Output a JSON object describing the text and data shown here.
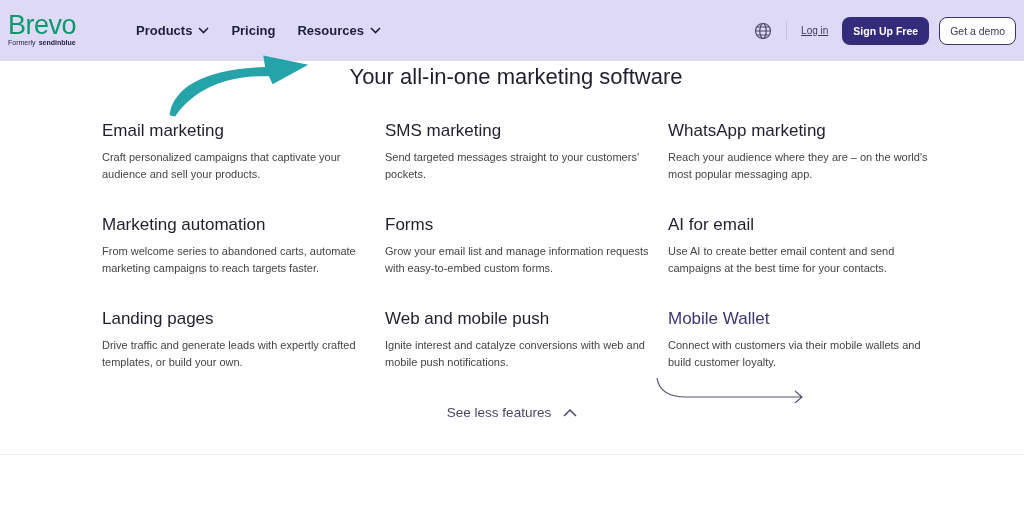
{
  "header": {
    "logo": "Brevo",
    "logo_sub_prefix": "Formerly",
    "logo_sub_brand": "sendinblue",
    "nav": [
      {
        "label": "Products",
        "dropdown": true
      },
      {
        "label": "Pricing",
        "dropdown": false
      },
      {
        "label": "Resources",
        "dropdown": true
      }
    ],
    "login": "Log in",
    "signup": "Sign Up Free",
    "demo": "Get a demo"
  },
  "heading": "Your all-in-one marketing software",
  "features": [
    {
      "title": "Email marketing",
      "text": "Craft personalized campaigns that captivate your audience and sell your products.",
      "highlighted": false
    },
    {
      "title": "SMS marketing",
      "text": "Send targeted messages straight to your customers' pockets.",
      "highlighted": false
    },
    {
      "title": "WhatsApp marketing",
      "text": "Reach your audience where they are – on the world's most popular messaging app.",
      "highlighted": false
    },
    {
      "title": "Marketing automation",
      "text": "From welcome series to abandoned carts, automate marketing campaigns to reach targets faster.",
      "highlighted": false
    },
    {
      "title": "Forms",
      "text": "Grow your email list and manage information requests with easy-to-embed custom forms.",
      "highlighted": false
    },
    {
      "title": "AI for email",
      "text": "Use AI to create better email content and send campaigns at the best time for your contacts.",
      "highlighted": false
    },
    {
      "title": "Landing pages",
      "text": "Drive traffic and generate leads with expertly crafted templates, or build your own.",
      "highlighted": false
    },
    {
      "title": "Web and mobile push",
      "text": "Ignite interest and catalyze conversions with web and mobile push notifications.",
      "highlighted": false
    },
    {
      "title": "Mobile Wallet",
      "text": "Connect with customers via their mobile wallets and build customer loyalty.",
      "highlighted": true
    }
  ],
  "toggle": {
    "label": "See less features",
    "expanded": true
  }
}
